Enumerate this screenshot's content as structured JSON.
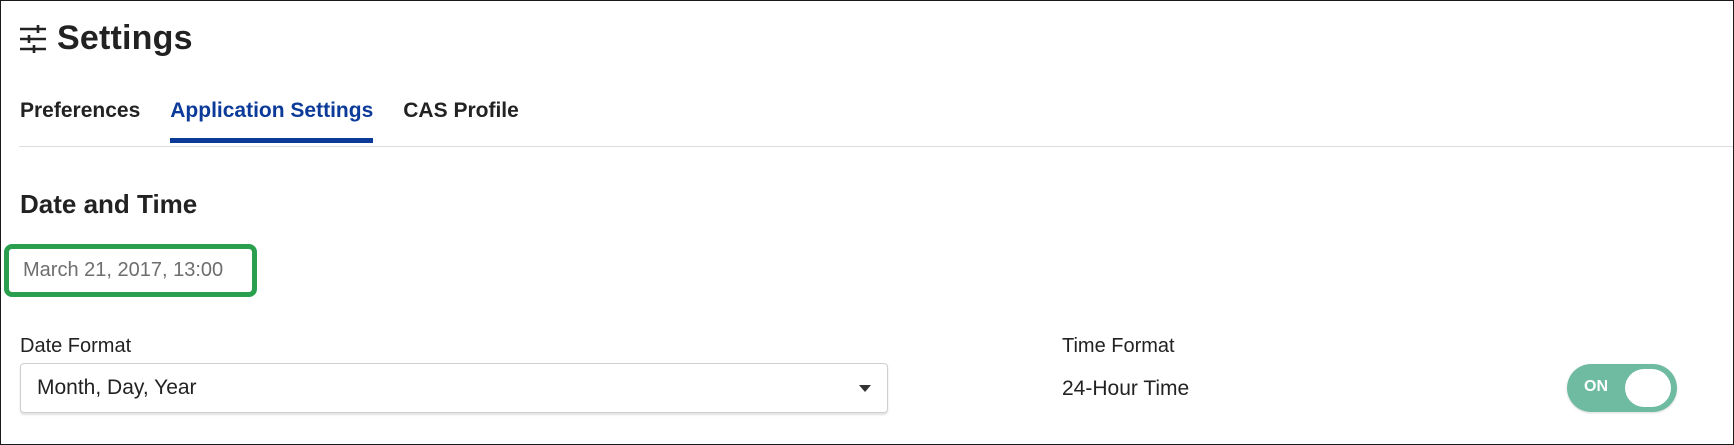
{
  "header": {
    "title": "Settings",
    "icon": "sliders-icon"
  },
  "tabs": [
    {
      "label": "Preferences",
      "active": false
    },
    {
      "label": "Application Settings",
      "active": true
    },
    {
      "label": "CAS Profile",
      "active": false
    }
  ],
  "section": {
    "title": "Date and Time",
    "preview": "March 21, 2017, 13:00"
  },
  "date_format": {
    "label": "Date Format",
    "selected": "Month, Day, Year"
  },
  "time_format": {
    "label": "Time Format",
    "value": "24-Hour Time",
    "toggle_label": "ON",
    "toggle_on": true
  },
  "colors": {
    "accent": "#0b3a99",
    "highlight": "#2aa04f",
    "toggle_on": "#6fbba2"
  }
}
